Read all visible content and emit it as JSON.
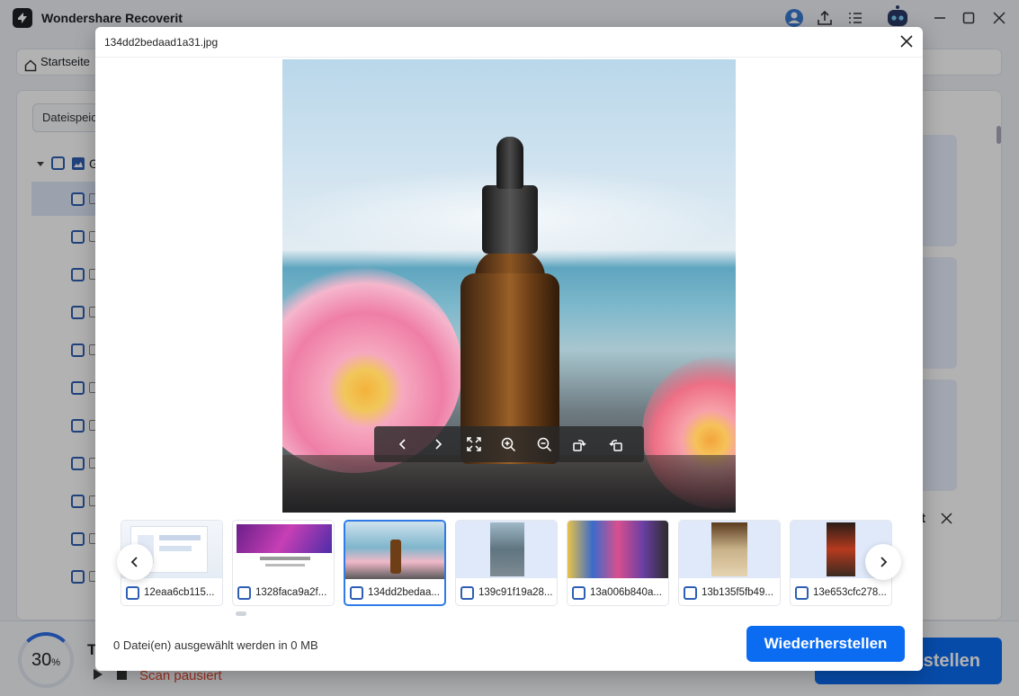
{
  "app": {
    "title": "Wondershare Recoverit"
  },
  "nav": {
    "home_label": "Startseite"
  },
  "panel": {
    "tab_label": "Dateispeic",
    "tree_label": "G"
  },
  "bottom": {
    "progress_value": "30",
    "progress_unit": "%",
    "title_letter": "T",
    "scan_status": "Scan pausiert",
    "recover_label": "stellen"
  },
  "side_popup": {
    "letter": "t"
  },
  "modal": {
    "title": "134dd2bedaad1a31.jpg",
    "selected_info": "0 Datei(en) ausgewählt werden in 0 MB",
    "recover_label": "Wiederherstellen",
    "thumbnails": [
      {
        "name": "12eaa6cb115..."
      },
      {
        "name": "1328faca9a2f..."
      },
      {
        "name": "134dd2bedaa..."
      },
      {
        "name": "139c91f19a28..."
      },
      {
        "name": "13a006b840a..."
      },
      {
        "name": "13b135f5fb49..."
      },
      {
        "name": "13e653cfc278..."
      }
    ]
  },
  "icons": {
    "toolbar": [
      "prev-icon",
      "next-icon",
      "fullscreen-icon",
      "zoom-in-icon",
      "zoom-out-icon",
      "rotate-left-icon",
      "rotate-right-icon"
    ]
  },
  "colors": {
    "accent": "#0b6cf2",
    "active_border": "#2f7be8",
    "status_red": "#e0452d"
  }
}
